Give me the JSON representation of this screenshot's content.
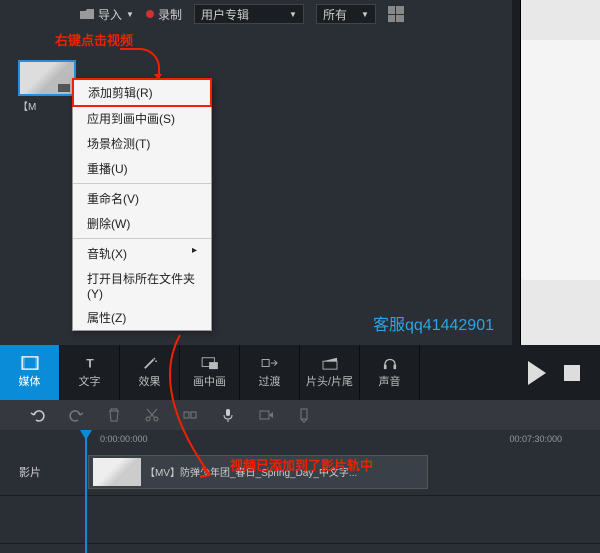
{
  "toolbar": {
    "import": "导入",
    "record": "录制",
    "category_dropdown": "用户专辑",
    "filter_dropdown": "所有"
  },
  "annotations": {
    "right_click": "右键点击视频",
    "added_to_track": "视频已添加到了影片轨中",
    "qq": "客服qq41442901"
  },
  "thumbnail": {
    "label": "【M"
  },
  "context_menu": {
    "add_clip": "添加剪辑(R)",
    "apply_pip": "应用到画中画(S)",
    "scene_detect": "场景检测(T)",
    "replay": "重播(U)",
    "rename": "重命名(V)",
    "delete": "删除(W)",
    "audio_track": "音轨(X)",
    "open_folder": "打开目标所在文件夹(Y)",
    "properties": "属性(Z)"
  },
  "tabs": {
    "media": "媒体",
    "text": "文字",
    "effects": "效果",
    "pip": "画中画",
    "transition": "过渡",
    "intro": "片头/片尾",
    "sound": "声音"
  },
  "timeline": {
    "start": "0:00:00:000",
    "end": "00:07:30:000",
    "track_label": "影片",
    "clip_title": "【MV】防弹少年团_春日_Spring_Day_中文字..."
  }
}
